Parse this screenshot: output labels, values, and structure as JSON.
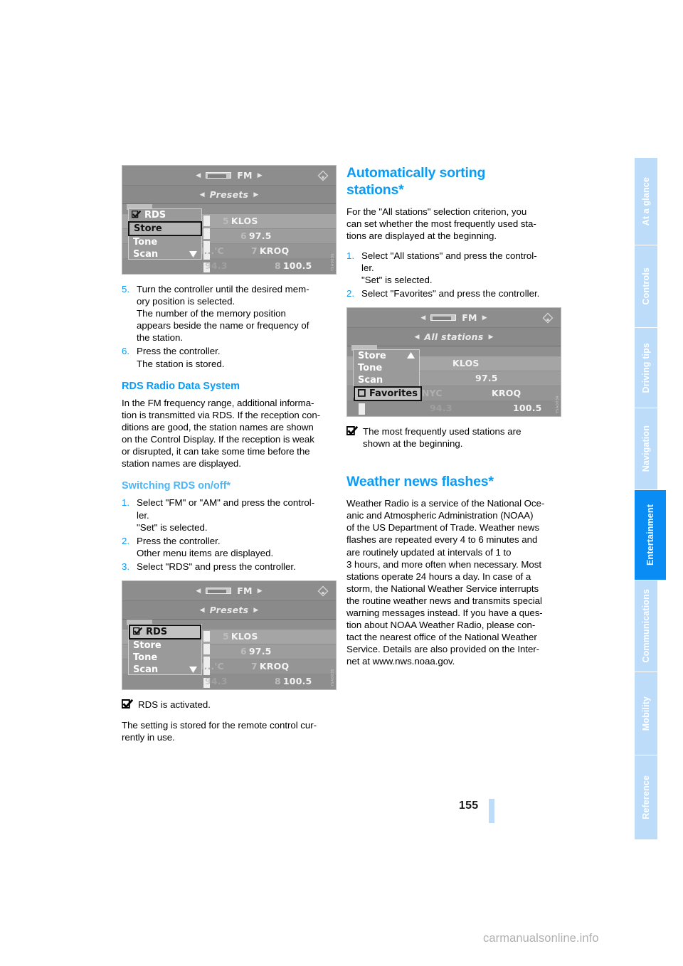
{
  "page": {
    "number": "155",
    "watermark": "carmanualsonline.info"
  },
  "rail": {
    "tabs": [
      {
        "label": "At a glance",
        "active": false
      },
      {
        "label": "Controls",
        "active": false
      },
      {
        "label": "Driving tips",
        "active": false
      },
      {
        "label": "Navigation",
        "active": false
      },
      {
        "label": "Entertainment",
        "active": true
      },
      {
        "label": "Communications",
        "active": false
      },
      {
        "label": "Mobility",
        "active": false
      },
      {
        "label": "Reference",
        "active": false
      }
    ],
    "active_color": "#0a8cf5",
    "inactive_color": "#bcdcfa"
  },
  "left_column": {
    "figure_1": {
      "code": "YSA0036",
      "source_label": "FM",
      "submenu_label": "Presets",
      "menu_items": [
        "RDS",
        "Store",
        "Tone",
        "Scan"
      ],
      "selected_item": "Store",
      "checkbox_item": "RDS",
      "stations": [
        {
          "num": "5",
          "name": "KLOS"
        },
        {
          "num": "6",
          "name": "97.5"
        },
        {
          "num": "7",
          "name": "KROQ"
        },
        {
          "num": "8",
          "name": "100.5"
        }
      ],
      "partial_left": [
        "N...'C",
        "94.3"
      ]
    },
    "step5": {
      "num": "5.",
      "text": "Turn the controller until the desired memory position is selected.\nThe number of the memory position appears beside the name or frequency of the station."
    },
    "step6": {
      "num": "6.",
      "text": "Press the controller.\nThe station is stored."
    },
    "rds_heading": "RDS Radio Data System",
    "rds_para": "In the FM frequency range, additional information is transmitted via RDS. If the reception conditions are good, the station names are shown on the Control Display. If the reception is weak or disrupted, it can take some time before the station names are displayed.",
    "switching_heading": "Switching RDS on/off*",
    "switching_steps": [
      {
        "num": "1.",
        "text": "Select \"FM\" or \"AM\" and press the controller.\n\"Set\" is selected."
      },
      {
        "num": "2.",
        "text": "Press the controller.\nOther menu items are displayed."
      },
      {
        "num": "3.",
        "text": "Select \"RDS\" and press the controller."
      }
    ],
    "figure_2": {
      "code": "YSA0035",
      "source_label": "FM",
      "submenu_label": "Presets",
      "menu_items": [
        "RDS",
        "Store",
        "Tone",
        "Scan"
      ],
      "selected_item": "RDS",
      "stations": [
        {
          "num": "5",
          "name": "KLOS"
        },
        {
          "num": "6",
          "name": "97.5"
        },
        {
          "num": "7",
          "name": "KROQ"
        },
        {
          "num": "8",
          "name": "100.5"
        }
      ],
      "partial_left": [
        "N...'C",
        "94.3"
      ]
    },
    "note_rds": "RDS is activated.",
    "closing_para": "The setting is stored for the remote control currently in use."
  },
  "right_column": {
    "heading_1": "Automatically sorting stations*",
    "intro_para": "For the \"All stations\" selection criterion, you can set whether the most frequently used stations are displayed at the beginning.",
    "steps": [
      {
        "num": "1.",
        "text": "Select \"All stations\" and press the controller.\n\"Set\" is selected."
      },
      {
        "num": "2.",
        "text": "Select \"Favorites\" and press the controller."
      }
    ],
    "figure_3": {
      "code": "YSA0034",
      "source_label": "FM",
      "submenu_label": "All stations",
      "menu_items": [
        "Store",
        "Tone",
        "Scan",
        "Favorites"
      ],
      "selected_item": "Favorites",
      "stations": [
        {
          "num": "",
          "name": "KLOS"
        },
        {
          "num": "",
          "name": "97.5"
        },
        {
          "num": "",
          "name": "KROQ"
        },
        {
          "num": "",
          "name": "100.5"
        }
      ],
      "partial_left": [
        "...NYC",
        "94.3"
      ]
    },
    "note_favorites": "The most frequently used stations are shown at the beginning.",
    "heading_2": "Weather news flashes*",
    "weather_para": "Weather Radio is a service of the National Oceanic and Atmospheric Administration (NOAA) of the US Department of Trade. Weather news flashes are repeated every 4 to 6 minutes and are routinely updated at intervals of 1 to 3 hours, and more often when necessary. Most stations operate 24 hours a day. In case of a storm, the National Weather Service interrupts the routine weather news and transmits special warning messages instead. If you have a question about NOAA Weather Radio, please contact the nearest office of the National Weather Service. Details are also provided on the Internet at www.nws.noaa.gov."
  }
}
